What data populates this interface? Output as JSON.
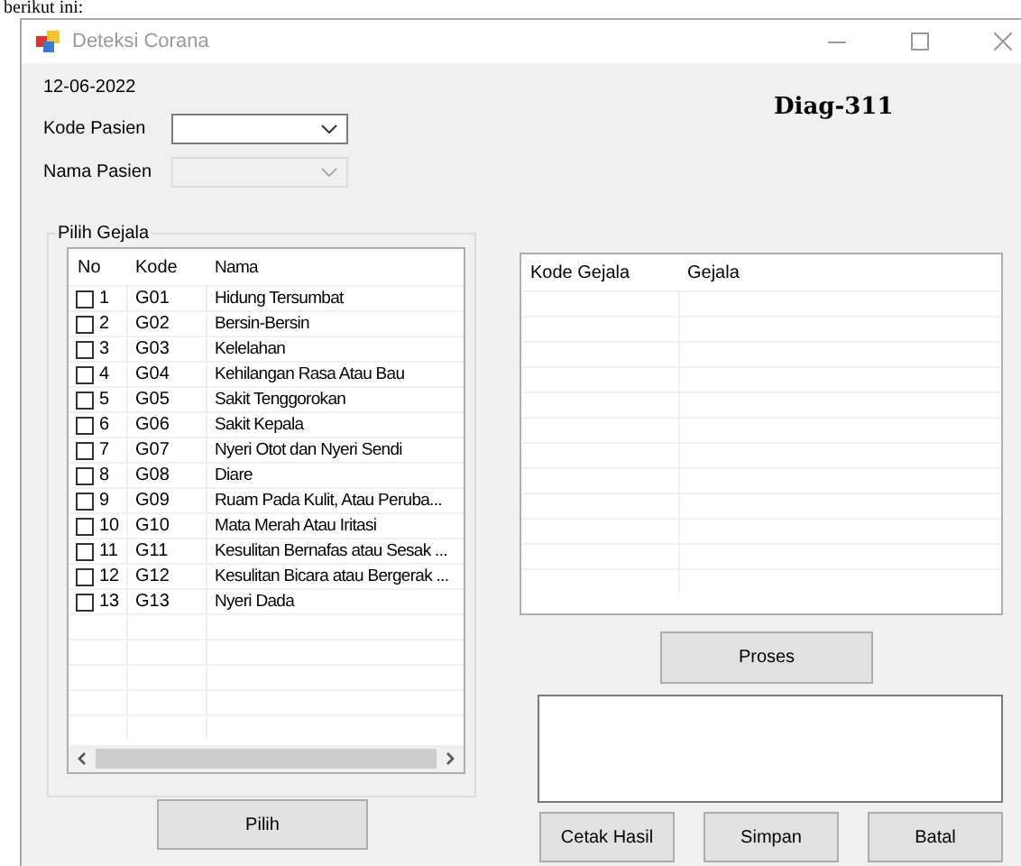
{
  "document_text": "berikut ini:",
  "window": {
    "title": "Deteksi Corana"
  },
  "date": "12-06-2022",
  "form_code": "Diag-311",
  "fields": [
    {
      "label": "Kode Pasien",
      "disabled": false
    },
    {
      "label": "Nama Pasien",
      "disabled": true
    }
  ],
  "symptom_group": {
    "title": "Pilih Gejala",
    "columns": [
      "No",
      "Kode",
      "Nama"
    ],
    "rows": [
      {
        "no": "1",
        "code": "G01",
        "name": "Hidung Tersumbat",
        "checked": false
      },
      {
        "no": "2",
        "code": "G02",
        "name": "Bersin-Bersin",
        "checked": false
      },
      {
        "no": "3",
        "code": "G03",
        "name": "Kelelahan",
        "checked": false
      },
      {
        "no": "4",
        "code": "G04",
        "name": "Kehilangan Rasa Atau Bau",
        "checked": false
      },
      {
        "no": "5",
        "code": "G05",
        "name": "Sakit Tenggorokan",
        "checked": false
      },
      {
        "no": "6",
        "code": "G06",
        "name": "Sakit Kepala",
        "checked": false
      },
      {
        "no": "7",
        "code": "G07",
        "name": "Nyeri Otot dan Nyeri Sendi",
        "checked": false
      },
      {
        "no": "8",
        "code": "G08",
        "name": "Diare",
        "checked": false
      },
      {
        "no": "9",
        "code": "G09",
        "name": "Ruam Pada Kulit, Atau Peruba...",
        "checked": false
      },
      {
        "no": "10",
        "code": "G10",
        "name": "Mata Merah Atau Iritasi",
        "checked": false
      },
      {
        "no": "11",
        "code": "G11",
        "name": "Kesulitan Bernafas atau Sesak ...",
        "checked": false
      },
      {
        "no": "12",
        "code": "G12",
        "name": "Kesulitan Bicara atau Bergerak ...",
        "checked": false
      },
      {
        "no": "13",
        "code": "G13",
        "name": "Nyeri Dada",
        "checked": false
      }
    ]
  },
  "pick_button": "Pilih",
  "result_table": {
    "columns": [
      "Kode Gejala",
      "Gejala"
    ]
  },
  "process_button": "Proses",
  "buttons": [
    "Cetak Hasil",
    "Simpan",
    "Batal"
  ]
}
